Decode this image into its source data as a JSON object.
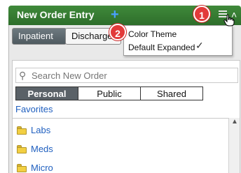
{
  "header": {
    "title": "New Order Entry",
    "add_icon": "plus-icon",
    "menu_icon": "hamburger-menu-icon",
    "collapse_icon": "chevron-up-icon",
    "color": "#2e6e2b"
  },
  "tabs": [
    "Inpatient",
    "Discharge"
  ],
  "search": {
    "placeholder": "Search New Order"
  },
  "segments": [
    "Personal",
    "Public",
    "Shared"
  ],
  "favorites_label": "Favorites",
  "folders": [
    "Labs",
    "Meds",
    "Micro"
  ],
  "dropdown": {
    "items": [
      "Color Theme",
      "Default Expanded"
    ],
    "check": "✓"
  },
  "callouts": [
    "1",
    "2"
  ],
  "colors": {
    "badge": "#e23a3a",
    "link": "#1f5fbf",
    "folder": "#f2cf42"
  }
}
